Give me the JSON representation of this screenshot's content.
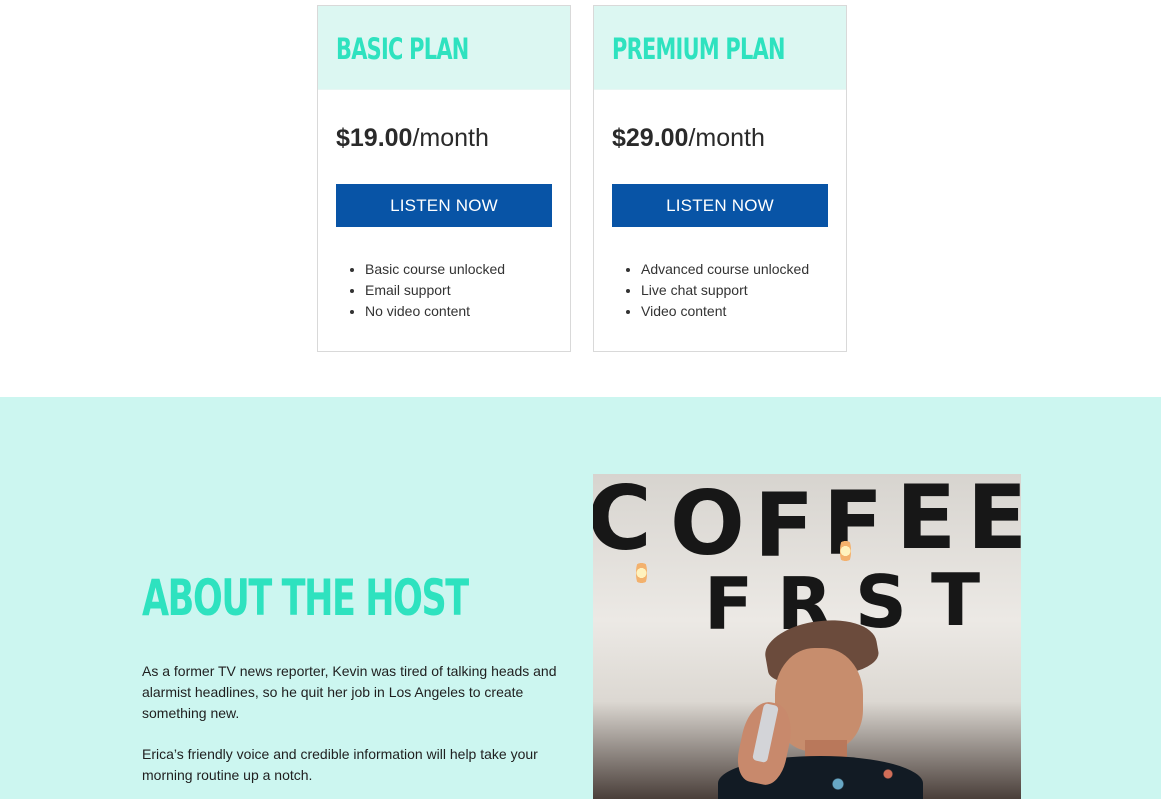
{
  "pricing": {
    "plans": [
      {
        "title": "Basic Plan",
        "price_amount": "$19.00",
        "price_period": "/month",
        "button_label": "LISTEN NOW",
        "features": [
          "Basic course unlocked",
          "Email support",
          "No video content"
        ]
      },
      {
        "title": "Premium Plan",
        "price_amount": "$29.00",
        "price_period": "/month",
        "button_label": "LISTEN NOW",
        "features": [
          "Advanced course unlocked",
          "Live chat support",
          "Video content"
        ]
      }
    ]
  },
  "about": {
    "title": "ABOUT THE HOST",
    "paragraphs": [
      "As a former TV news reporter, Kevin was tired of talking heads and alarmist headlines, so he quit her job in Los Angeles to create something new.",
      "Erica’s friendly voice and credible information will help take your morning routine up a notch."
    ],
    "photo": {
      "wall_text": [
        "C",
        "O",
        "F",
        "F",
        "E",
        "E",
        "F",
        "R",
        "S",
        "T"
      ]
    }
  },
  "colors": {
    "accent": "#2ee2bf",
    "primary_button": "#0854a6",
    "about_background": "#ccf6f0",
    "plan_header_background": "#dcf7f2"
  }
}
